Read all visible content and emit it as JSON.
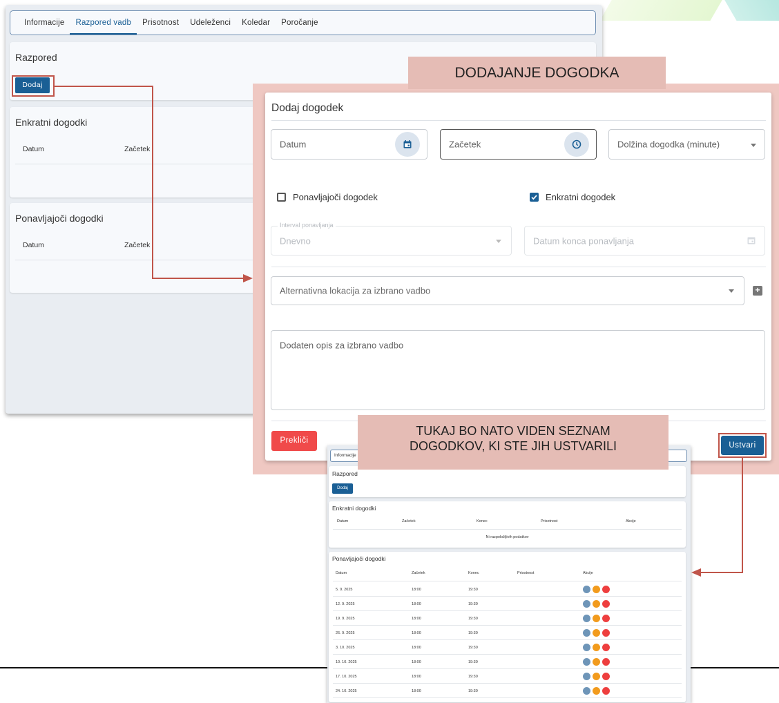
{
  "background_app": {
    "tabs": [
      "Informacije",
      "Razpored vadb",
      "Prisotnost",
      "Udeleženci",
      "Koledar",
      "Poročanje"
    ],
    "active_tab": "Razpored vadb",
    "schedule_title": "Razpored",
    "add_button": "Dodaj",
    "single_events_title": "Enkratni dogodki",
    "recurring_events_title": "Ponavljajoči dogodki",
    "col_date": "Datum",
    "col_start": "Začetek"
  },
  "annotations": {
    "dialog_label": "DODAJANJE DOGODKA",
    "list_label_line1": "TUKAJ BO NATO VIDEN SEZNAM",
    "list_label_line2": "DOGODKOV, KI STE JIH USTVARILI",
    "colors": {
      "highlight": "#c0554a",
      "label_bg": "#e5bcb5",
      "panel_bg": "#efc8c2"
    }
  },
  "dialog": {
    "title": "Dodaj dogodek",
    "date_placeholder": "Datum",
    "start_placeholder": "Začetek",
    "duration_placeholder": "Dolžina dogodka (minute)",
    "recurring_checkbox": {
      "label": "Ponavljajoči dogodek",
      "checked": false
    },
    "single_checkbox": {
      "label": "Enkratni dogodek",
      "checked": true
    },
    "interval_label": "Interval ponavljanja",
    "interval_value": "Dnevno",
    "repeat_end_placeholder": "Datum konca ponavljanja",
    "location_placeholder": "Alternativna lokacija za izbrano vadbo",
    "description_placeholder": "Dodaten opis za izbrano vadbo",
    "cancel_button": "Prekliči",
    "create_button": "Ustvari"
  },
  "result_preview": {
    "tab": "Informacije",
    "schedule_title": "Razpored",
    "add_button": "Dodaj",
    "single_title": "Enkratni dogodki",
    "single_columns": [
      "Datum",
      "Začetek",
      "Konec",
      "Prisotnost",
      "Akcije"
    ],
    "single_empty": "Ni razpoložljivih podatkov",
    "recurring_title": "Ponavljajoči dogodki",
    "recurring_columns": [
      "Datum",
      "Začetek",
      "Konec",
      "Prisotnost",
      "Akcije"
    ],
    "recurring_rows": [
      {
        "date": "5. 9. 2025",
        "start": "18:00",
        "end": "19:30"
      },
      {
        "date": "12. 9. 2025",
        "start": "18:00",
        "end": "19:30"
      },
      {
        "date": "19. 9. 2025",
        "start": "18:00",
        "end": "19:30"
      },
      {
        "date": "26. 9. 2025",
        "start": "18:00",
        "end": "19:30"
      },
      {
        "date": "3. 10. 2025",
        "start": "18:00",
        "end": "19:30"
      },
      {
        "date": "10. 10. 2025",
        "start": "18:00",
        "end": "19:30"
      },
      {
        "date": "17. 10. 2025",
        "start": "18:00",
        "end": "19:30"
      },
      {
        "date": "24. 10. 2025",
        "start": "18:00",
        "end": "19:30"
      }
    ]
  }
}
